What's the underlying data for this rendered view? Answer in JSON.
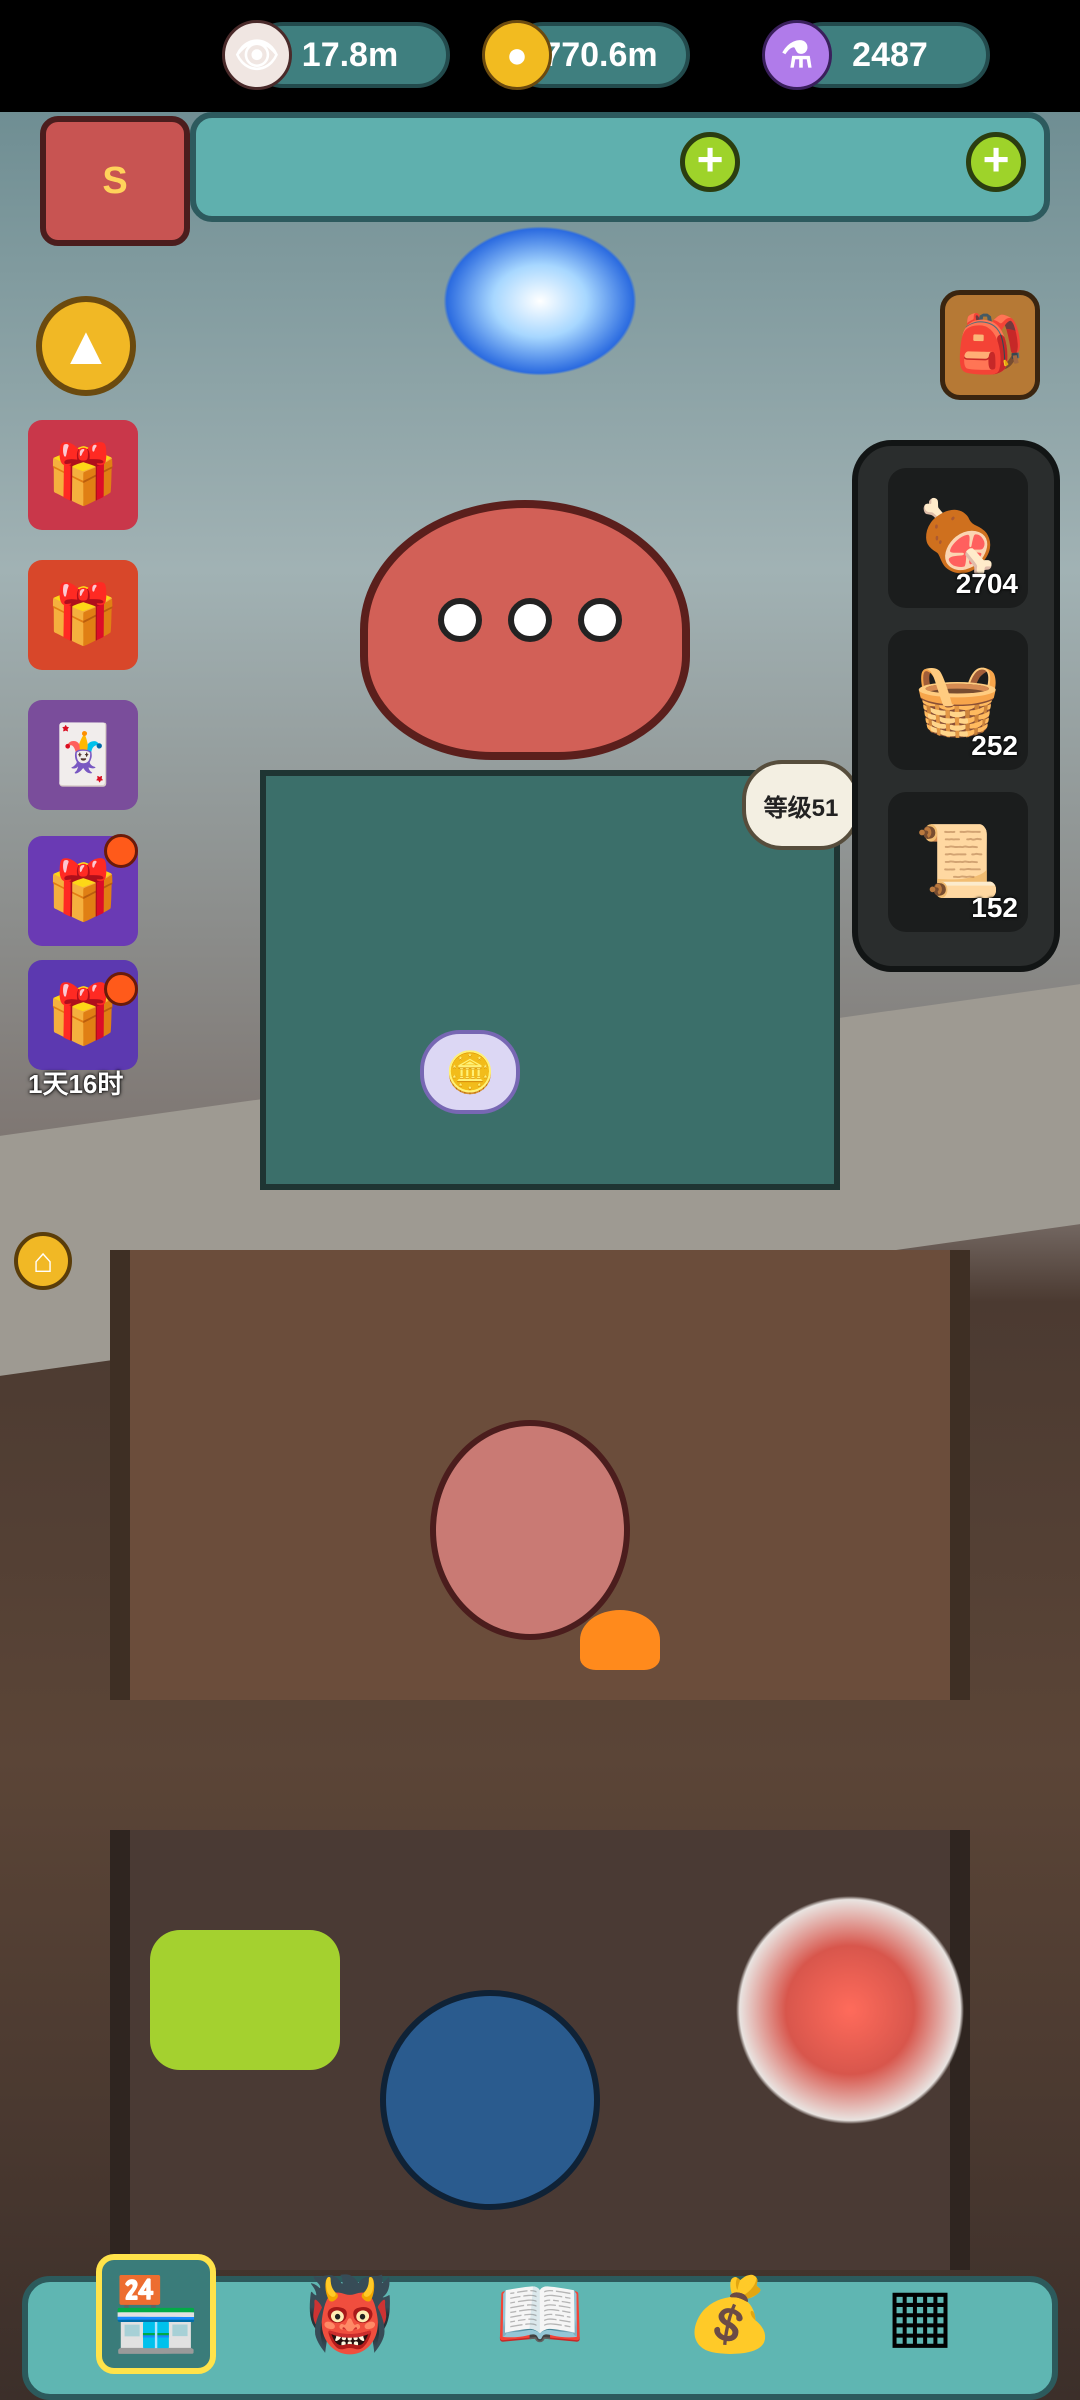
{
  "resources": {
    "eyes": {
      "icon": "eyeball-icon",
      "value": "17.8m"
    },
    "coins": {
      "icon": "gold-coin-icon",
      "value": "770.6m"
    },
    "potion": {
      "icon": "purple-potion-icon",
      "value": "2487"
    }
  },
  "side_panel": {
    "items": [
      {
        "icon": "meat-icon",
        "count": "2704"
      },
      {
        "icon": "ingredients-crate-icon",
        "count": "252"
      },
      {
        "icon": "recipe-scroll-icon",
        "count": "152"
      }
    ]
  },
  "left_menu": {
    "gift_timer": "1天16时"
  },
  "restaurant": {
    "level_label": "等级51"
  },
  "bottom_nav": [
    {
      "icon": "restaurant-building-icon",
      "active": true
    },
    {
      "icon": "monster-icon",
      "active": false
    },
    {
      "icon": "open-book-icon",
      "active": false
    },
    {
      "icon": "money-bag-icon",
      "active": false
    },
    {
      "icon": "grid-menu-icon",
      "active": false
    }
  ],
  "colors": {
    "panel_teal": "#5fb0ae",
    "plus_green": "#9ed32a",
    "alert_orange": "#ff5a1a",
    "active_yellow": "#ffe34a"
  }
}
